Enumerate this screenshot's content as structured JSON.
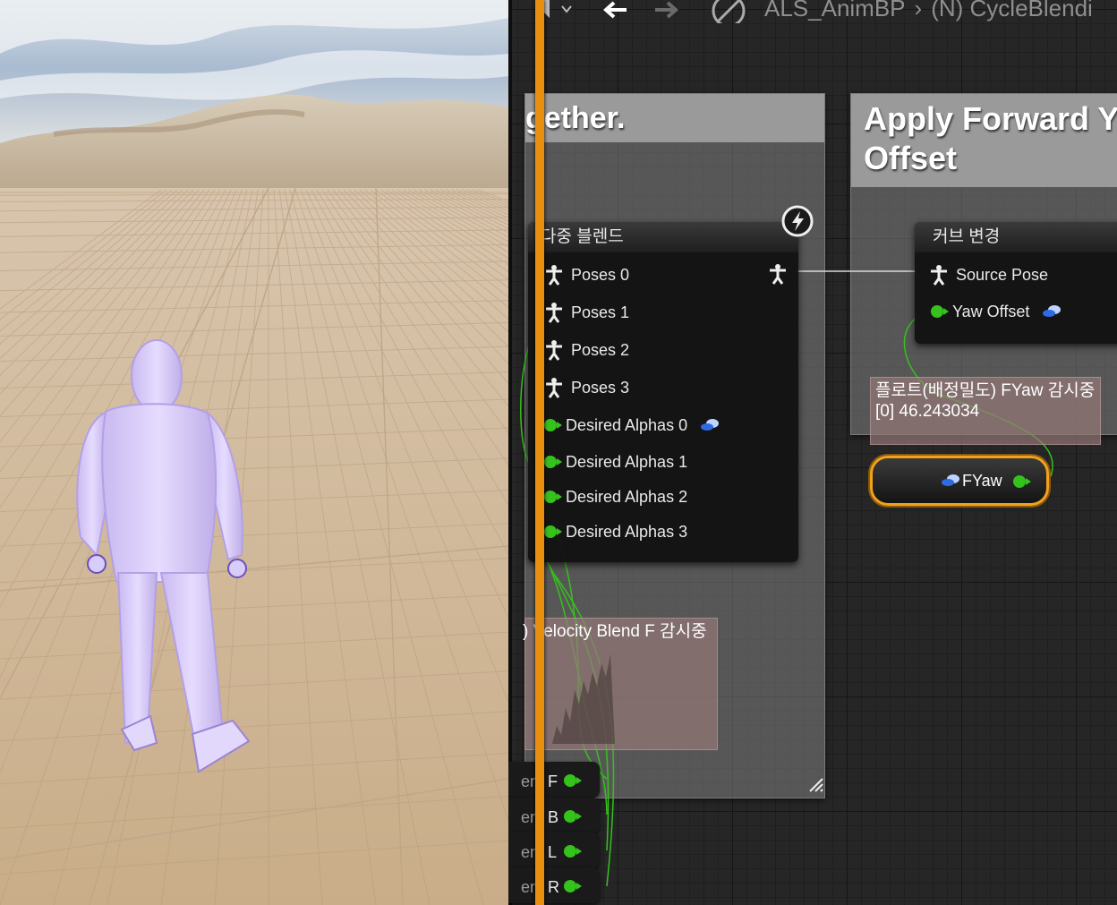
{
  "editor": {
    "breadcrumb": [
      "ALS_AnimBP",
      "(N) CycleBlendi"
    ]
  },
  "comments": {
    "left_title": "gether.",
    "right_title_line1": "Apply Forward Ya",
    "right_title_line2": "Offset"
  },
  "blend_node": {
    "title": "다중 블렌드",
    "pins": [
      {
        "label": "Poses 0",
        "type": "pose"
      },
      {
        "label": "Poses 1",
        "type": "pose"
      },
      {
        "label": "Poses 2",
        "type": "pose"
      },
      {
        "label": "Poses 3",
        "type": "pose"
      },
      {
        "label": "Desired Alphas 0",
        "type": "float"
      },
      {
        "label": "Desired Alphas 1",
        "type": "float"
      },
      {
        "label": "Desired Alphas 2",
        "type": "float"
      },
      {
        "label": "Desired Alphas 3",
        "type": "float"
      }
    ]
  },
  "curve_node": {
    "title": "커브 변경",
    "source_pose": "Source Pose",
    "yaw_offset": "Yaw Offset"
  },
  "watch_tooltip": {
    "line1": "플로트(배정밀도) FYaw 감시중",
    "line2": "[0] 46.243034"
  },
  "watch_tooltip_left": {
    "text": ") Velocity Blend F 감시중"
  },
  "fyaw_node": {
    "label": "FYaw"
  },
  "small_nodes": [
    {
      "prefix": "en",
      "label": "F"
    },
    {
      "prefix": "en",
      "label": "B"
    },
    {
      "prefix": "en",
      "label": "L"
    },
    {
      "prefix": "en",
      "label": "R"
    }
  ],
  "colors": {
    "float_pin": "#35c21c",
    "exec_wire": "#e8900e",
    "selected_outline": "#f4a11a"
  }
}
